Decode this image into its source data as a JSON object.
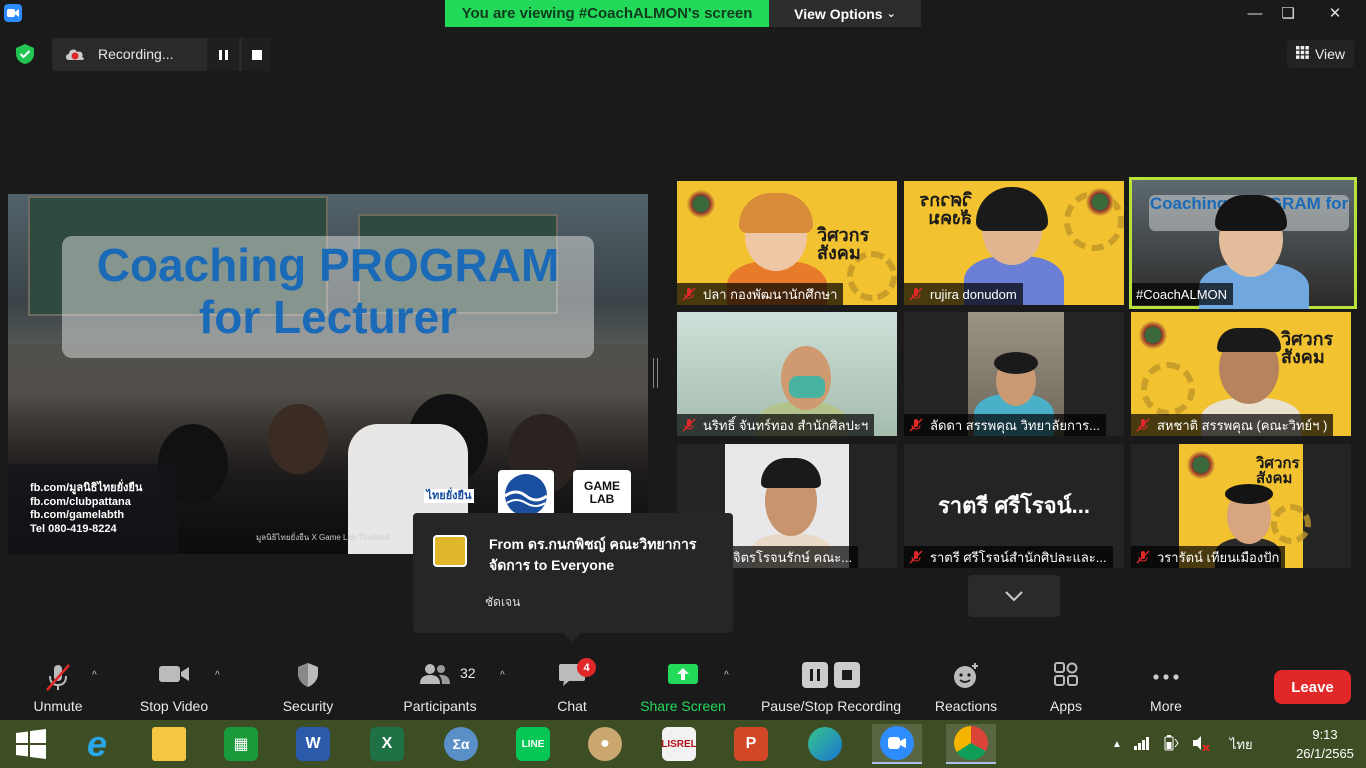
{
  "top_banner": {
    "viewing": "You are viewing #CoachALMON's screen",
    "view_options": "View Options"
  },
  "recording": {
    "label": "Recording..."
  },
  "view_button": "View",
  "slide": {
    "title_line1": "Coaching PROGRAM",
    "title_line2": "for Lecturer",
    "links": [
      "fb.com/มูลนิธิไทยยั่งยืน",
      "fb.com/clubpattana",
      "fb.com/gamelabth",
      "Tel 080-419-8224"
    ],
    "credit": "มูลนิธิไทยยั่งยืน X Game Lab Thailand",
    "logo_left": "ไทยยั่งยืน",
    "logo_right": "GAME LAB"
  },
  "participants": [
    {
      "name": "ปลา กองพัฒนานักศึกษา",
      "muted": true,
      "poster_title": "วิศวกร สังคม"
    },
    {
      "name": "rujira donudom",
      "muted": true,
      "poster_title": "วิศวกร สังคม"
    },
    {
      "name": "#CoachALMON",
      "muted": false,
      "active": true,
      "overlay": "Coaching PROGRAM for Lecturer"
    },
    {
      "name": "นริทธิ์ จันทร์ทอง สำนักศิลปะฯ",
      "muted": true
    },
    {
      "name": "ลัดดา สรรพคุณ วิทยาลัยการ...",
      "muted": true
    },
    {
      "name": "สหชาติ สรรพคุณ (คณะวิทย์ฯ )",
      "muted": true,
      "poster_title": "วิศวกร สังคม"
    },
    {
      "name": "นันท์ จิตรโรจนรักษ์ คณะ...",
      "muted": true
    },
    {
      "name": "ราตรี  ศรีโรจน์สำนักศิปละและ...",
      "muted": true,
      "big_label": "ราตรี   ศรีโรจน์..."
    },
    {
      "name": "วรารัตน์ เทียนเมืองปัก",
      "muted": true,
      "poster_title": "วิศวกร สังคม"
    }
  ],
  "chat_toast": {
    "from": "From ดร.กนกพิชญ์ คณะวิทยาการจัดการ to Everyone",
    "message": "ชัดเจน"
  },
  "toolbar": {
    "unmute": "Unmute",
    "stop_video": "Stop Video",
    "security": "Security",
    "participants": "Participants",
    "participants_count": "32",
    "chat": "Chat",
    "chat_badge": "4",
    "share_screen": "Share Screen",
    "pause_stop_recording": "Pause/Stop Recording",
    "reactions": "Reactions",
    "apps": "Apps",
    "more": "More",
    "leave": "Leave"
  },
  "taskbar": {
    "tray_lang": "ไทย",
    "time": "9:13",
    "date": "26/1/2565"
  },
  "colors": {
    "green_banner": "#23d959",
    "leave_red": "#e02828",
    "active_outline": "#b9e13c",
    "taskbar": "#3d4e24"
  }
}
